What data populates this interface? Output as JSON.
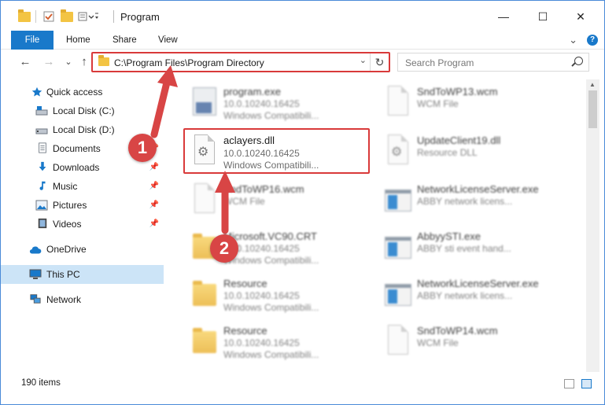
{
  "window": {
    "title": "Program",
    "minimize": "—",
    "maximize": "☐",
    "close": "✕"
  },
  "ribbon": {
    "tabs": [
      "File",
      "Home",
      "Share",
      "View"
    ],
    "expand": "⌄",
    "help": "?"
  },
  "nav": {
    "back": "←",
    "forward": "→",
    "recent": "⌄",
    "up": "↑",
    "address": "C:\\Program Files\\Program Directory",
    "address_dropdown": "⌄",
    "refresh": "↻",
    "search_placeholder": "Search Program"
  },
  "sidebar": {
    "items": [
      {
        "label": "Quick access",
        "icon": "star-icon"
      },
      {
        "label": "Local Disk (C:)",
        "icon": "drive-icon"
      },
      {
        "label": "Local Disk (D:)",
        "icon": "drive-icon"
      },
      {
        "label": "Documents",
        "icon": "documents-icon"
      },
      {
        "label": "Downloads",
        "icon": "download-icon"
      },
      {
        "label": "Music",
        "icon": "music-icon"
      },
      {
        "label": "Pictures",
        "icon": "pictures-icon"
      },
      {
        "label": "Videos",
        "icon": "videos-icon"
      },
      {
        "label": "OneDrive",
        "icon": "cloud-icon"
      },
      {
        "label": "This PC",
        "icon": "computer-icon"
      },
      {
        "label": "Network",
        "icon": "network-icon"
      }
    ]
  },
  "files": {
    "left": [
      {
        "name": "program.exe",
        "line1": "10.0.10240.16425",
        "line2": "Windows Compatibili..."
      },
      {
        "name": "aclayers.dll",
        "line1": "10.0.10240.16425",
        "line2": "Windows Compatibili..."
      },
      {
        "name": "SndToWP16.wcm",
        "line1": "WCM File",
        "line2": ""
      },
      {
        "name": "Microsoft.VC90.CRT",
        "line1": "10.0.10240.16425",
        "line2": "Windows Compatibili..."
      },
      {
        "name": "Resource",
        "line1": "10.0.10240.16425",
        "line2": "Windows Compatibili..."
      },
      {
        "name": "Resource",
        "line1": "10.0.10240.16425",
        "line2": "Windows Compatibili..."
      }
    ],
    "right": [
      {
        "name": "SndToWP13.wcm",
        "line1": "WCM File",
        "line2": ""
      },
      {
        "name": "UpdateClient19.dll",
        "line1": "Resource DLL",
        "line2": ""
      },
      {
        "name": "NetworkLicenseServer.exe",
        "line1": "ABBY network licens...",
        "line2": ""
      },
      {
        "name": "AbbyySTI.exe",
        "line1": "ABBY sti event hand...",
        "line2": ""
      },
      {
        "name": "NetworkLicenseServer.exe",
        "line1": "ABBY network licens...",
        "line2": ""
      },
      {
        "name": "SndToWP14.wcm",
        "line1": "WCM File",
        "line2": ""
      }
    ]
  },
  "status": {
    "count": "190 items"
  },
  "annotations": {
    "step1": "1",
    "step2": "2"
  },
  "colors": {
    "accent": "#1979ca",
    "highlight": "#d93a3a",
    "selection": "#cce4f7"
  }
}
